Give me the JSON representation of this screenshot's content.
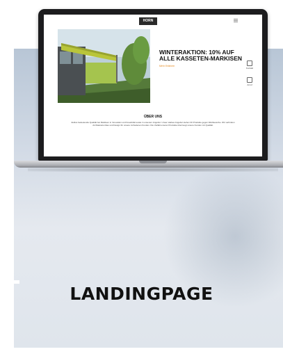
{
  "site": {
    "logo": "HORN",
    "hero_headline": "WINTERAKTION: 10% AUF ALLE KASSETEN-MARKISEN",
    "hero_sub": "Mehr Erfahren",
    "side_buttons": [
      "Kontakt",
      "Anruf"
    ],
    "about_title": "ÜBER UNS",
    "about_text": "Zeitlos bedeutende Qualität bei Markisen in Innovation und Kreativität sowie in unserem Angebot. Unser starkes Angebot stehen 30 Produkte gegen Wettbewerbe. Wir verbinden Architekturumbau und Design für unsere zufriedenen Kunden. Die Vielfalt unserer Produkte überzeugt unsere Kunden mit Qualität."
  },
  "page_title": "LANDINGPAGE",
  "colors": {
    "accent": "#e48a20",
    "background_panel": "#cfd8e3"
  }
}
